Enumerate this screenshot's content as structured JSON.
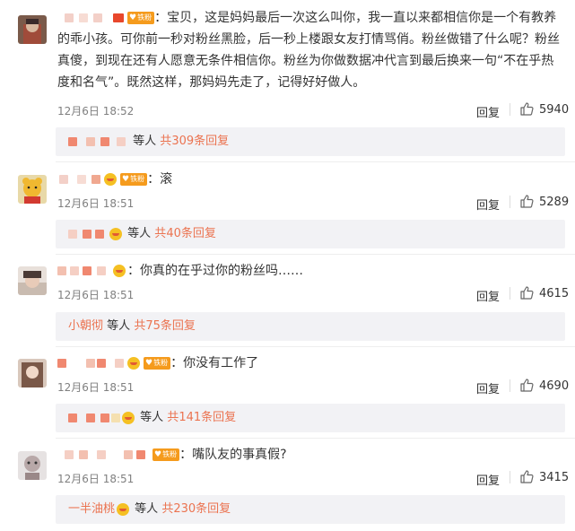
{
  "labels": {
    "reply": "回复",
    "badge": "铁粉",
    "etc": "等人",
    "total_prefix": "共",
    "total_suffix": "条回复"
  },
  "comments": [
    {
      "text": "宝贝，这是妈妈最后一次这么叫你，我一直以来都相信你是一个有教养的乖小孩。可你前一秒对粉丝黑脸，后一秒上楼跟女友打情骂俏。粉丝做错了什么呢？粉丝真傻，到现在还有人愿意无条件相信你。粉丝为你做数据冲代言到最后换来一句“不在乎热度和名气”。既然这样，那妈妈先走了，记得好好做人。",
      "date": "12月6日 18:52",
      "likes": "5940",
      "reply_count": "309",
      "reply_name": ""
    },
    {
      "text": "滚",
      "date": "12月6日 18:51",
      "likes": "5289",
      "reply_count": "40",
      "reply_name": ""
    },
    {
      "text": "你真的在乎过你的粉丝吗……",
      "date": "12月6日 18:51",
      "likes": "4615",
      "reply_count": "75",
      "reply_name": "小朝彻"
    },
    {
      "text": "你没有工作了",
      "date": "12月6日 18:51",
      "likes": "4690",
      "reply_count": "141",
      "reply_name": ""
    },
    {
      "text": "嘴队友的事真假?",
      "date": "12月6日 18:51",
      "likes": "3415",
      "reply_count": "230",
      "reply_name": "一半油桃"
    }
  ]
}
